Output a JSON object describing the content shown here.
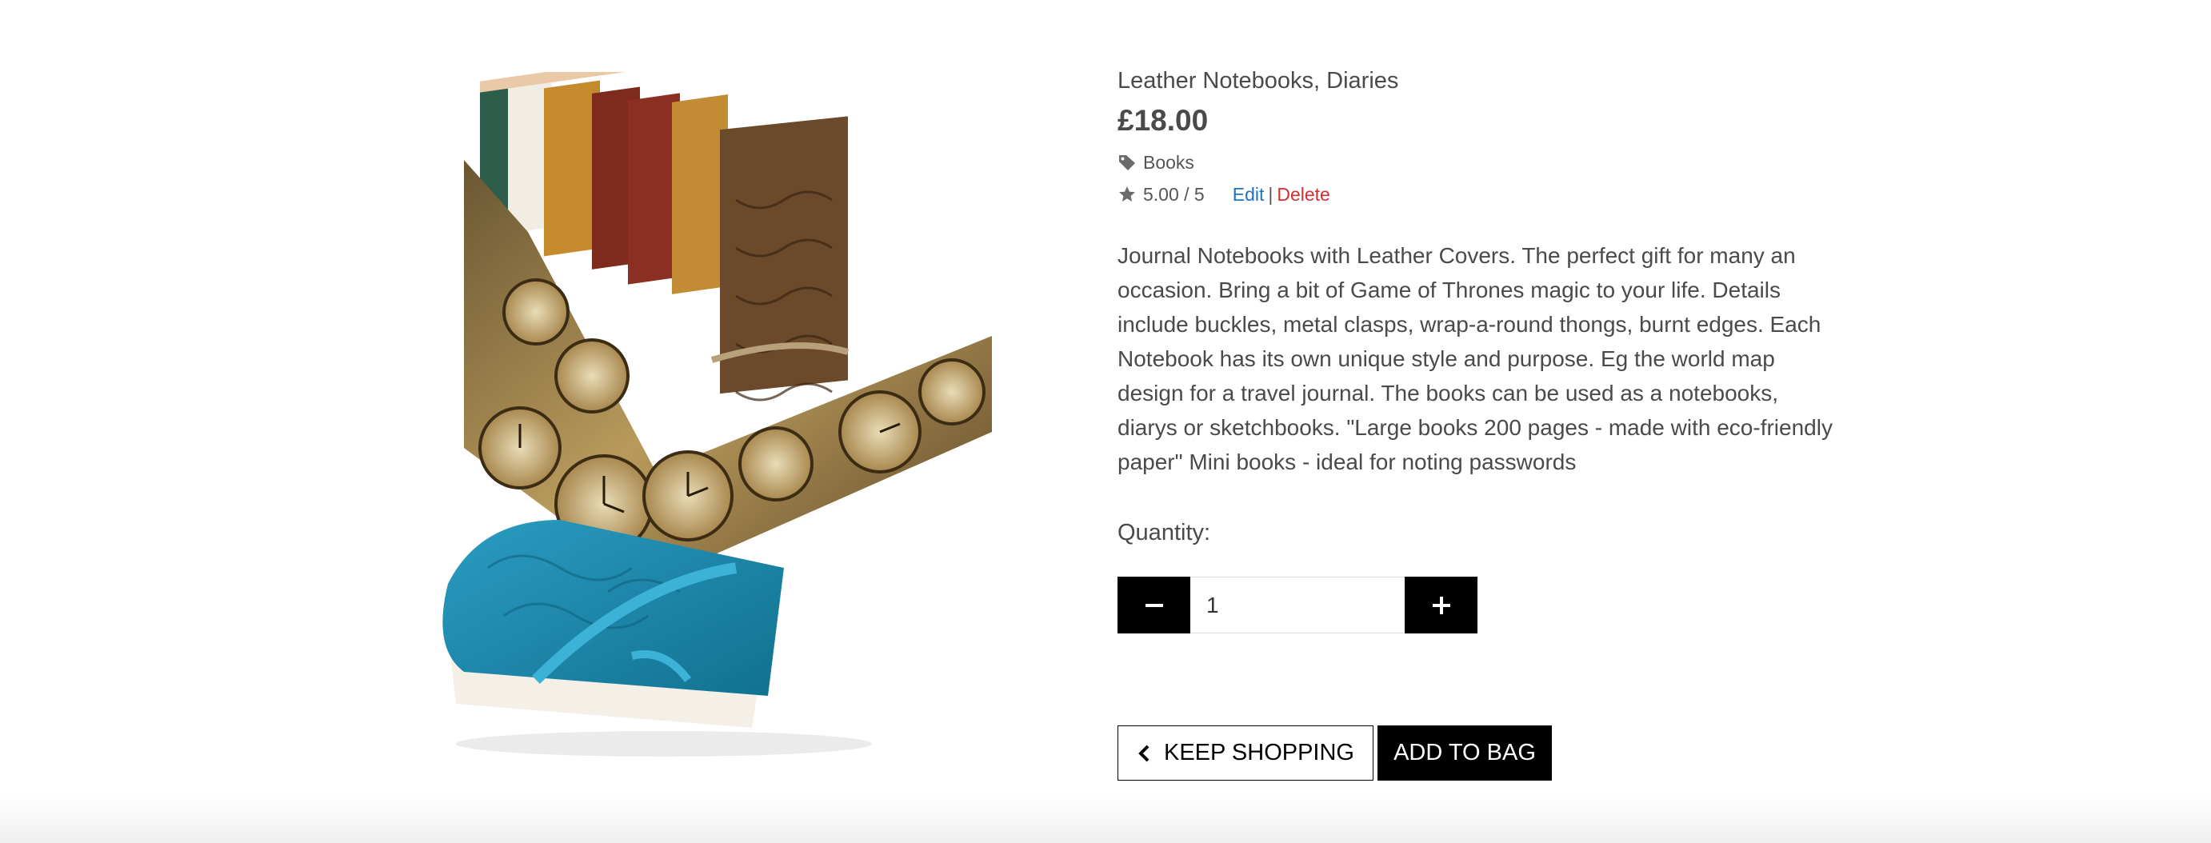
{
  "product": {
    "name": "Leather Notebooks, Diaries",
    "price": "£18.00",
    "category": "Books",
    "rating": "5.00 / 5",
    "description": "Journal Notebooks with Leather Covers. The perfect gift for many an occasion. Bring a bit of Game of Thrones magic to your life. Details include buckles, metal clasps, wrap-a-round thongs, burnt edges. Each Notebook has its own unique style and purpose. Eg the world map design for a travel journal. The books can be used as a notebooks, diarys or sketchbooks. \"Large books 200 pages - made with eco-friendly paper\" Mini books - ideal for noting passwords"
  },
  "admin": {
    "edit_label": "Edit",
    "separator": "|",
    "delete_label": "Delete"
  },
  "quantity": {
    "label": "Quantity:",
    "value": "1"
  },
  "actions": {
    "keep_shopping_label": "Keep Shopping",
    "add_to_bag_label": "Add to Bag"
  },
  "icons": {
    "category": "tag-icon",
    "rating": "star-icon",
    "decrement": "minus-icon",
    "increment": "plus-icon",
    "back": "chevron-left-icon"
  },
  "colors": {
    "edit_link": "#1a73c7",
    "delete_link": "#d0302f",
    "primary_button": "#000000",
    "text": "#4a4a4a"
  }
}
